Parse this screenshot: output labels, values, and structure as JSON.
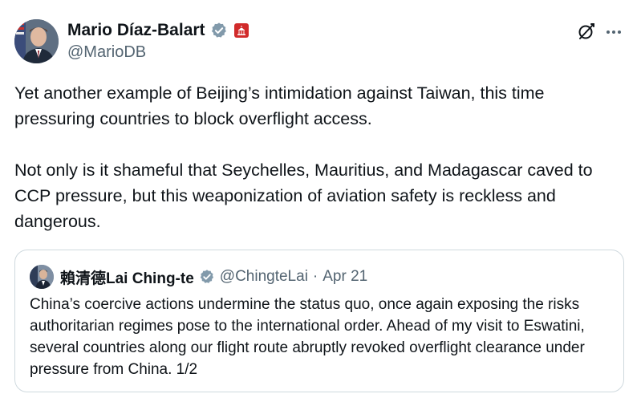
{
  "tweet": {
    "author": {
      "display_name": "Mario Díaz-Balart",
      "handle": "@MarioDB",
      "verified_icon": "verified-badge-icon",
      "affiliation_icon": "us-capitol-icon"
    },
    "actions": {
      "grok_icon": "grok-icon",
      "more_icon": "more-icon"
    },
    "paragraphs": [
      "Yet another example of Beijing’s intimidation against Taiwan, this time pressuring countries to block overflight access.",
      "Not only is it shameful that Seychelles, Mauritius, and Madagascar caved to CCP pressure, but this weaponization of aviation safety is reckless and dangerous."
    ]
  },
  "quote": {
    "author": {
      "display_name": "賴清德Lai Ching-te",
      "handle": "@ChingteLai",
      "separator": "·",
      "date": "Apr 21"
    },
    "text": "China’s coercive actions undermine the status quo, once again exposing the risks authoritarian regimes pose to the international order. Ahead of my visit to Eswatini, several countries along our flight route abruptly revoked overflight clearance under pressure from China. 1/2"
  },
  "colors": {
    "text_primary": "#0f1419",
    "text_secondary": "#536471",
    "verified_blue": "#829aab",
    "border": "#cfd9de",
    "affiliation_red": "#d12b2b"
  }
}
